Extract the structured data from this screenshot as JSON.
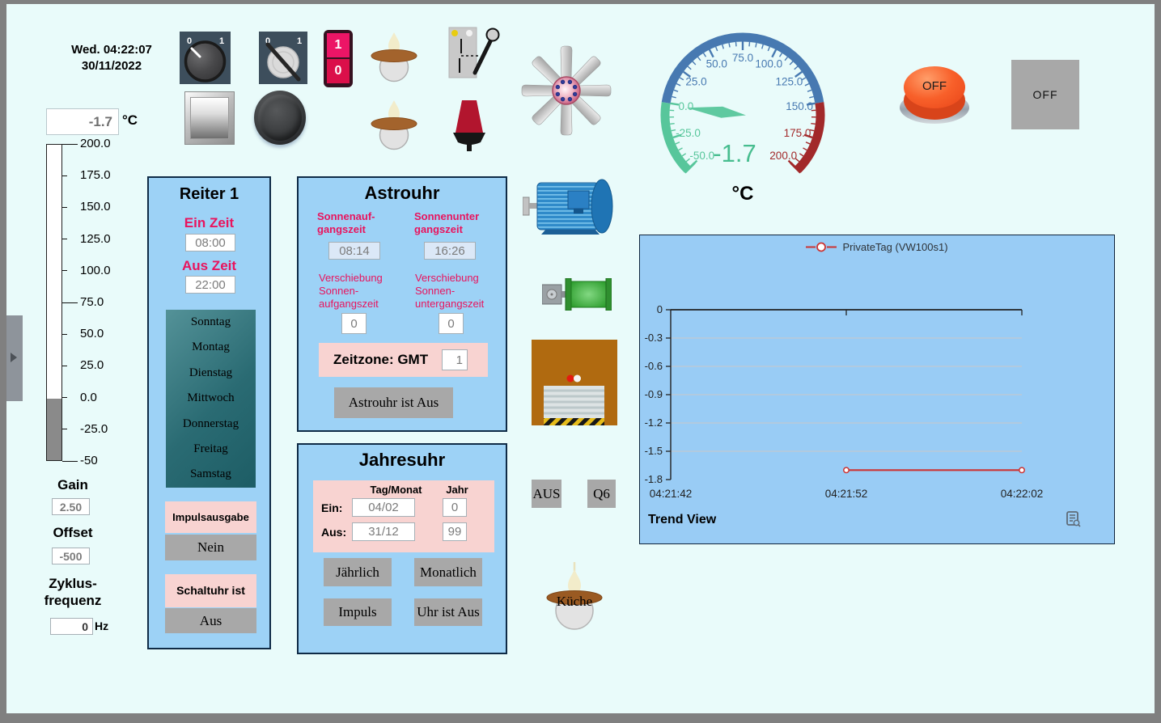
{
  "clock": {
    "line1": "Wed. 04:22:07",
    "line2": "30/11/2022"
  },
  "temp_readout": {
    "value": "-1.7",
    "unit": "°C"
  },
  "bar_meter": {
    "min": -50,
    "max": 200,
    "value": -1.7,
    "fill_color": "#8a8a8a",
    "ticks": [
      {
        "value": 200,
        "label": "200.0",
        "major": true
      },
      {
        "value": 175,
        "label": "175.0"
      },
      {
        "value": 150,
        "label": "150.0"
      },
      {
        "value": 125,
        "label": "125.0"
      },
      {
        "value": 100,
        "label": "100.0"
      },
      {
        "value": 75,
        "label": "75.0",
        "major": true
      },
      {
        "value": 50,
        "label": "50.0"
      },
      {
        "value": 25,
        "label": "25.0"
      },
      {
        "value": 0,
        "label": "0.0"
      },
      {
        "value": -25,
        "label": "-25.0"
      },
      {
        "value": -50,
        "label": "-50",
        "major": true
      }
    ]
  },
  "gain": {
    "label": "Gain",
    "value": "2.50"
  },
  "offset": {
    "label": "Offset",
    "value": "-500"
  },
  "cycle": {
    "label": "Zyklus-\nfrequenz",
    "value": "0",
    "unit": "Hz"
  },
  "switches": {
    "rotary_a": {
      "off_label": "0",
      "on_label": "1"
    },
    "rotary_b": {
      "off_label": "0",
      "on_label": "1"
    },
    "rocker": {
      "on_label": "1",
      "off_label": "0"
    }
  },
  "gauge": {
    "min": -50,
    "max": 200,
    "value": -1.7,
    "display": "-1.7",
    "unit": "°C",
    "needle_color": "#5fc9a0",
    "value_color": "#47bd8f",
    "zones": [
      {
        "from": -50,
        "to": 0,
        "color": "#57c69b"
      },
      {
        "from": 0,
        "to": 150,
        "color": "#4779b1"
      },
      {
        "from": 150,
        "to": 200,
        "color": "#a2292a"
      }
    ],
    "tick_labels": [
      {
        "value": -50,
        "label": "-50.0",
        "color": "#57c69b"
      },
      {
        "value": -25,
        "label": "-25.0",
        "color": "#57c69b"
      },
      {
        "value": 0,
        "label": "0.0",
        "color": "#57c69b"
      },
      {
        "value": 25,
        "label": "25.0",
        "color": "#4779b1"
      },
      {
        "value": 50,
        "label": "50.0",
        "color": "#4779b1"
      },
      {
        "value": 75,
        "label": "75.0",
        "color": "#4779b1"
      },
      {
        "value": 100,
        "label": "100.0",
        "color": "#4779b1"
      },
      {
        "value": 125,
        "label": "125.0",
        "color": "#4779b1"
      },
      {
        "value": 150,
        "label": "150.0",
        "color": "#4779b1"
      },
      {
        "value": 175,
        "label": "175.0",
        "color": "#a2292a"
      },
      {
        "value": 200,
        "label": "200.0",
        "color": "#a2292a"
      }
    ]
  },
  "buttons": {
    "off_round": "OFF",
    "off_square": "OFF"
  },
  "reiter": {
    "title": "Reiter 1",
    "ein_label": "Ein Zeit",
    "ein_value": "08:00",
    "aus_label": "Aus Zeit",
    "aus_value": "22:00",
    "days": [
      "Sonntag",
      "Montag",
      "Dienstag",
      "Mittwoch",
      "Donnerstag",
      "Freitag",
      "Samstag"
    ],
    "impuls_label": "Impulsausgabe",
    "impuls_value": "Nein",
    "schaltuhr_label": "Schaltuhr ist",
    "schaltuhr_value": "Aus"
  },
  "astro": {
    "title": "Astrouhr",
    "sunrise_label": "Sonnenauf-\ngangszeit",
    "sunrise_value": "08:14",
    "sunset_label": "Sonnenunter\ngangszeit",
    "sunset_value": "16:26",
    "shift_sunrise_label": "Verschiebung\nSonnen-\naufgangszeit",
    "shift_sunrise_value": "0",
    "shift_sunset_label": "Verschiebung\nSonnen-\nuntergangszeit",
    "shift_sunset_value": "0",
    "timezone_label": "Zeitzone: GMT",
    "timezone_value": "1",
    "status_button": "Astrouhr ist Aus"
  },
  "jahres": {
    "title": "Jahresuhr",
    "col_day_month": "Tag/Monat",
    "col_year": "Jahr",
    "ein_label": "Ein:",
    "ein_day_month": "04/02",
    "ein_year": "0",
    "aus_label": "Aus:",
    "aus_day_month": "31/12",
    "aus_year": "99",
    "buttons": [
      "Jährlich",
      "Monatlich",
      "Impuls",
      "Uhr ist Aus"
    ]
  },
  "device_buttons": {
    "aus": "AUS",
    "q6": "Q6"
  },
  "kueche_label": "Küche",
  "trend": {
    "legend": "PrivateTag (VW100s1)",
    "title": "Trend View",
    "chart_data": {
      "type": "line",
      "x_range": [
        "04:21:42",
        "04:22:02"
      ],
      "x_ticks": [
        "04:21:42",
        "04:21:52",
        "04:22:02"
      ],
      "y_range": [
        0,
        -1.8
      ],
      "y_ticks": [
        {
          "v": 0,
          "label": "0"
        },
        {
          "v": -0.3,
          "label": "-0.3"
        },
        {
          "v": -0.6,
          "label": "-0.6"
        },
        {
          "v": -0.9,
          "label": "-0.9"
        },
        {
          "v": -1.2,
          "label": "-1.2"
        },
        {
          "v": -1.5,
          "label": "-1.5"
        },
        {
          "v": -1.8,
          "label": "-1.8"
        }
      ],
      "series": [
        {
          "name": "PrivateTag (VW100s1)",
          "color": "#cc3333",
          "points": [
            {
              "t": "04:21:52",
              "v": -1.7
            },
            {
              "t": "04:22:02",
              "v": -1.7
            }
          ]
        }
      ]
    }
  },
  "icons": [
    "rotary-switch-icon",
    "lever-switch-icon",
    "rocker-switch-icon",
    "metal-button-icon",
    "round-button-icon",
    "lamp-icon",
    "knife-switch-icon",
    "signal-lamp-icon",
    "fan-icon",
    "motor-icon",
    "valve-icon",
    "shutter-icon",
    "report-icon",
    "side-tab-arrow-icon",
    "legend-marker-icon"
  ]
}
